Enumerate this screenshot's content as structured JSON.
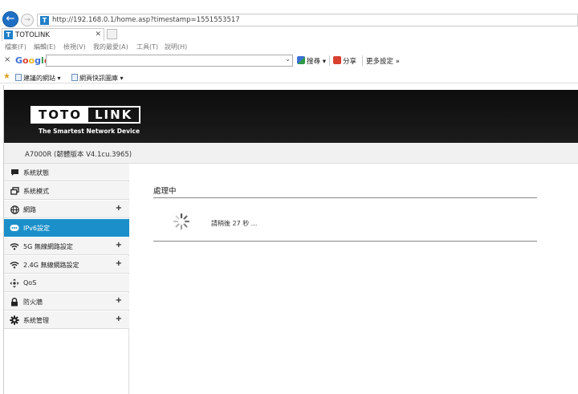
{
  "browser": {
    "url": "http://192.168.0.1/home.asp?timestamp=1551553517",
    "tab_title": "TOTOLINK",
    "menu": [
      "檔案(F)",
      "編輯(E)",
      "檢視(V)",
      "我的最愛(A)",
      "工具(T)",
      "說明(H)"
    ],
    "google": {
      "logo": "Google",
      "search_label": "搜尋",
      "share_label": "分享",
      "more_label": "更多設定 »"
    },
    "favorites": [
      "建議的網站 ▾",
      "網頁快訊圖庫 ▾"
    ]
  },
  "router": {
    "logo_left": "TOTO",
    "logo_right": "LINK",
    "slogan": "The Smartest Network Device",
    "model": "A7000R (韌體版本 V4.1cu.3965)",
    "nav": [
      {
        "label": "系統狀態",
        "icon": "chat-icon",
        "plus": ""
      },
      {
        "label": "系統模式",
        "icon": "windows-icon",
        "plus": ""
      },
      {
        "label": "網路",
        "icon": "globe-icon",
        "plus": "+"
      },
      {
        "label": "IPv6設定",
        "icon": "ipv6-icon",
        "plus": ""
      },
      {
        "label": "5G 無線網路設定",
        "icon": "wifi-icon",
        "plus": "+"
      },
      {
        "label": "2.4G 無線網路設定",
        "icon": "wifi-icon",
        "plus": "+"
      },
      {
        "label": "QoS",
        "icon": "qos-icon",
        "plus": ""
      },
      {
        "label": "防火牆",
        "icon": "lock-icon",
        "plus": "+"
      },
      {
        "label": "系統管理",
        "icon": "gear-icon",
        "plus": "+"
      }
    ],
    "active_index": 3,
    "accent": "#1b8fc9",
    "content": {
      "title": "處理中",
      "message": "請稍後 27 秒 ..."
    }
  }
}
